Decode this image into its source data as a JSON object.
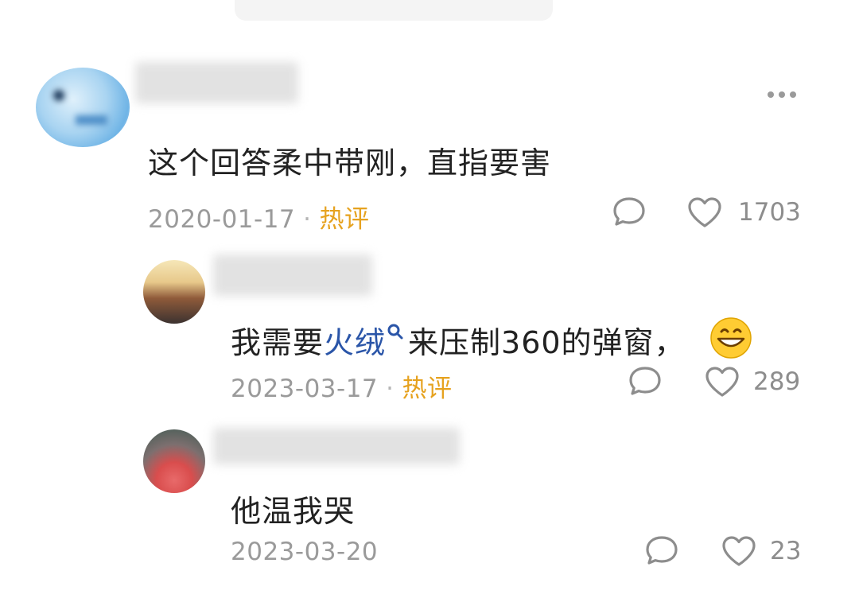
{
  "comments": [
    {
      "text": "这个回答柔中带刚，直指要害",
      "date": "2020-01-17",
      "hot_label": "热评",
      "likes": "1703"
    },
    {
      "text_before": "我需要",
      "link_text": "火绒",
      "text_after": "来压制360的弹窗，",
      "emoji": "😄",
      "date": "2023-03-17",
      "hot_label": "热评",
      "likes": "289"
    },
    {
      "text": "他温我哭",
      "date": "2023-03-20",
      "likes": "23"
    }
  ],
  "colors": {
    "hot_label": "#e6a21f",
    "link": "#2a55a8",
    "meta": "#9a9a9a"
  },
  "icons": [
    "more-icon",
    "comment-icon",
    "heart-icon",
    "search-icon"
  ]
}
